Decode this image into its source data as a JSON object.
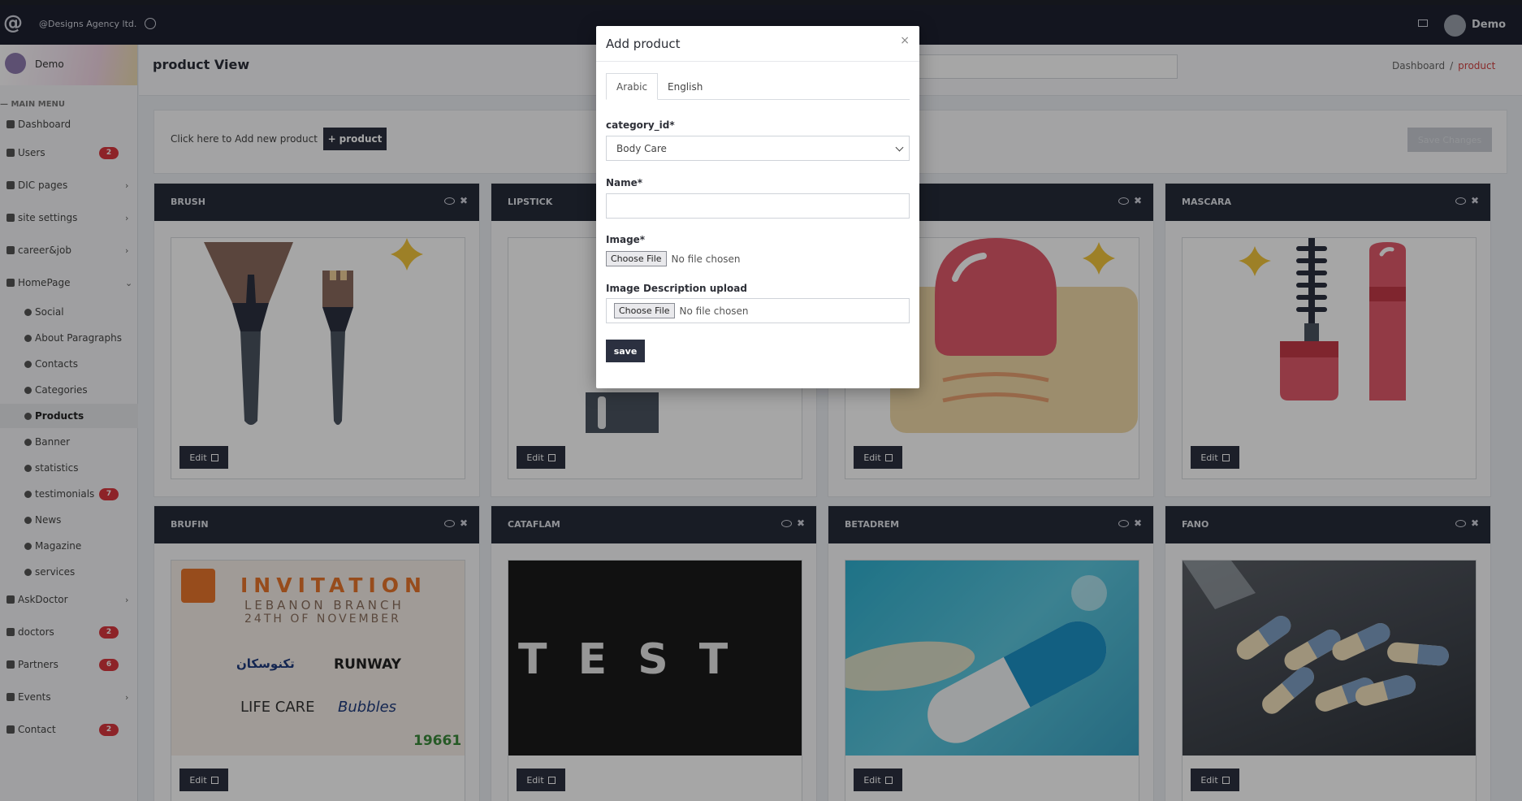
{
  "header": {
    "brand": "@Designs Agency ltd.",
    "user": "Demo"
  },
  "sidebar": {
    "user": "Demo",
    "menu_label": "— MAIN MENU",
    "items": [
      {
        "label": "Dashboard"
      },
      {
        "label": "Users",
        "badge": "2"
      },
      {
        "label": "DIC pages",
        "chevron": "›"
      },
      {
        "label": "site settings",
        "chevron": "›"
      },
      {
        "label": "career&job",
        "chevron": "›"
      },
      {
        "label": "HomePage",
        "chevron": "⌄"
      },
      {
        "label": "Social"
      },
      {
        "label": "About Paragraphs"
      },
      {
        "label": "Contacts"
      },
      {
        "label": "Categories"
      },
      {
        "label": "Products"
      },
      {
        "label": "Banner"
      },
      {
        "label": "statistics"
      },
      {
        "label": "testimonials",
        "badge": "7"
      },
      {
        "label": "News"
      },
      {
        "label": "Magazine"
      },
      {
        "label": "services"
      },
      {
        "label": "AskDoctor",
        "chevron": "›"
      },
      {
        "label": "doctors",
        "badge": "2"
      },
      {
        "label": "Partners",
        "badge": "6"
      },
      {
        "label": "Events",
        "chevron": "›"
      },
      {
        "label": "Contact",
        "badge": "2"
      }
    ]
  },
  "page": {
    "title": "product View",
    "breadcrumb": [
      "Dashboard",
      "/",
      "product"
    ],
    "add_text": "Click here to Add new product",
    "add_button": "product",
    "save_changes": "Save Changes"
  },
  "cards": [
    {
      "name": "BRUSH",
      "edit": "Edit",
      "image": "brush-illustration"
    },
    {
      "name": "LIPSTICK",
      "edit": "Edit",
      "image": "lipstick-illustration"
    },
    {
      "name": "",
      "edit": "Edit",
      "image": "nail-polish-illustration"
    },
    {
      "name": "MASCARA",
      "edit": "Edit",
      "image": "mascara-illustration"
    },
    {
      "name": "BRUFIN",
      "edit": "Edit",
      "image": "invitation-poster",
      "poster": {
        "title": "INVITATION",
        "line1": "LEBANON BRANCH",
        "line2": "24TH OF NOVEMBER",
        "brands": [
          "تكنوسكان",
          "RUNWAY",
          "LIFE CARE",
          "Bubbles"
        ],
        "number": "19661"
      }
    },
    {
      "name": "CATAFLAM",
      "edit": "Edit",
      "image": "test-banner",
      "banner_text": "T E S T"
    },
    {
      "name": "BETADREM",
      "edit": "Edit",
      "image": "capsule-photo"
    },
    {
      "name": "FANO",
      "edit": "Edit",
      "image": "pills-photo"
    }
  ],
  "modal": {
    "title": "Add product",
    "close": "×",
    "tabs": [
      "Arabic",
      "English"
    ],
    "category_label": "category_id*",
    "category_value": "Body Care",
    "name_label": "Name*",
    "image_label": "Image*",
    "choose_file": "Choose File",
    "no_file": "No file chosen",
    "desc_label": "Image Description upload",
    "save": "save"
  },
  "colors": {
    "navy": "#262b3a",
    "badge": "#d9363e",
    "crumb_active": "#d24242"
  }
}
